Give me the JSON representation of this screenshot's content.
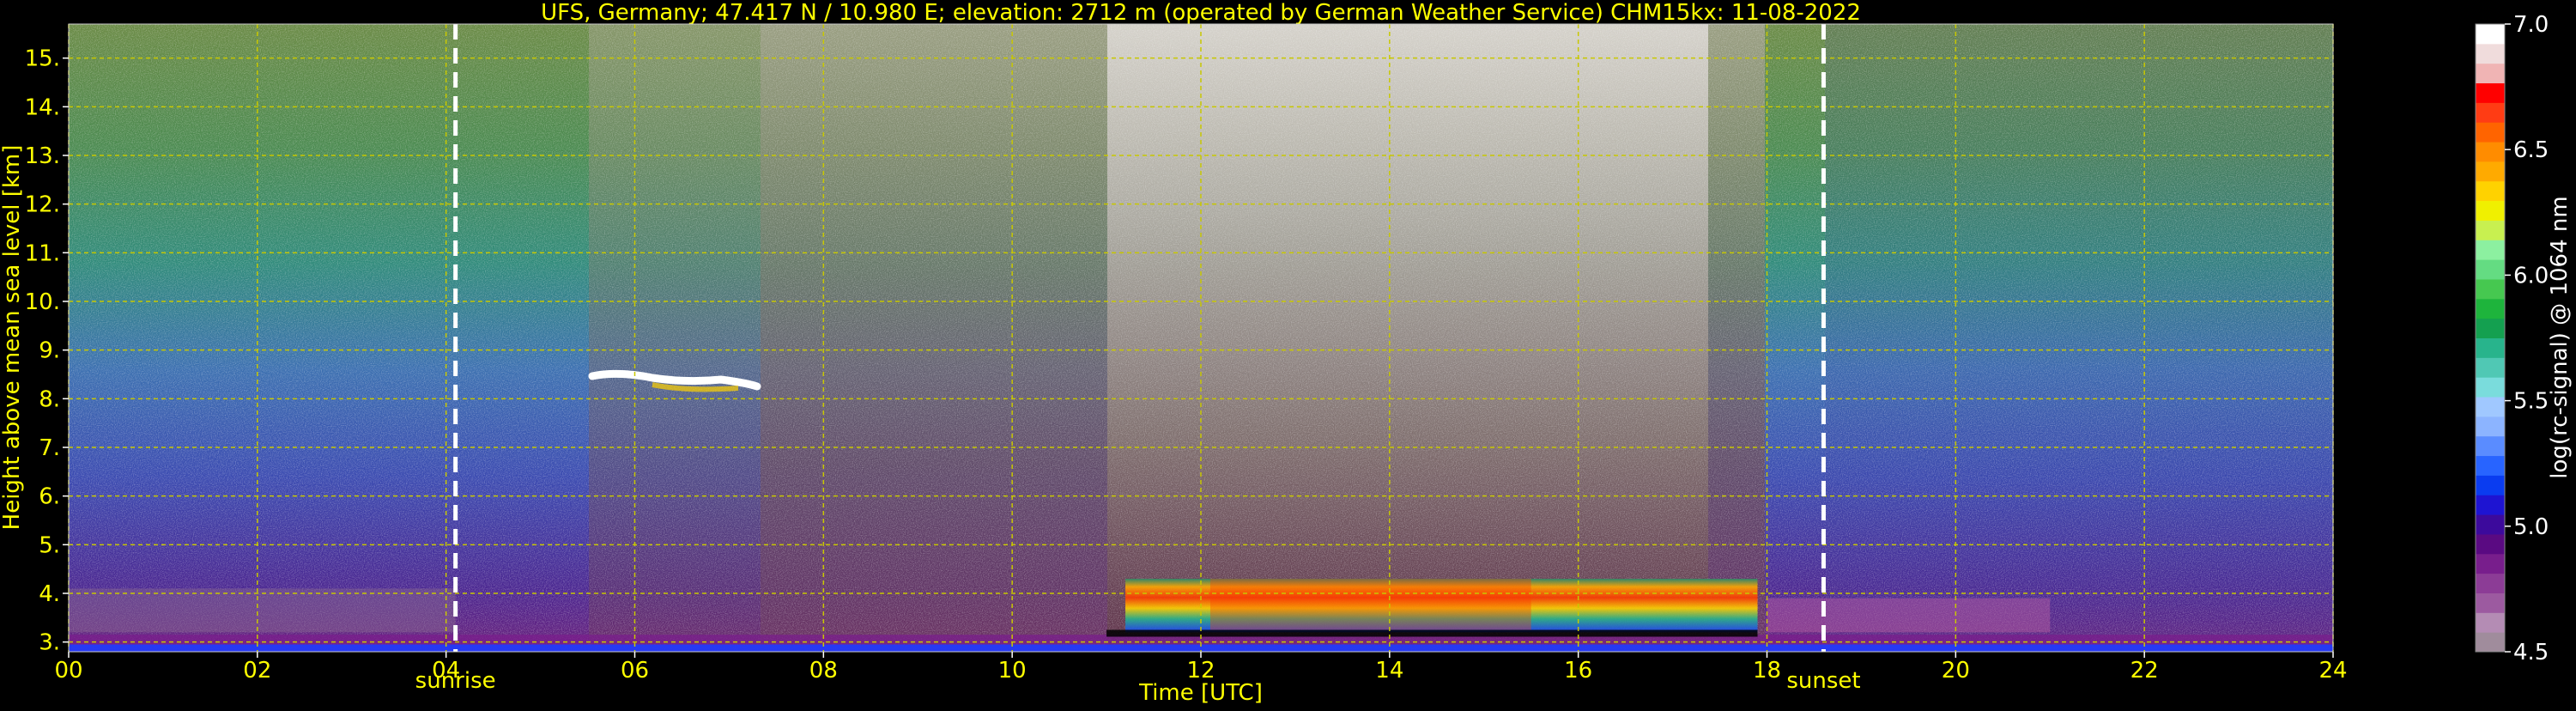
{
  "title": "UFS, Germany; 47.417 N / 10.980 E; elevation: 2712 m  (operated by German Weather Service)    CHM15kx: 11-08-2022",
  "colors": {
    "text_yellow": "#ffff00",
    "grid_yellow": "#c8c800",
    "background": "#000000",
    "colorbar_text": "#ffffff"
  },
  "chart_data": {
    "type": "heatmap",
    "title": "UFS, Germany; 47.417 N / 10.980 E; elevation: 2712 m  (operated by German Weather Service)    CHM15kx: 11-08-2022",
    "xlabel": "Time [UTC]",
    "ylabel": "Height above mean sea level [km]",
    "xlim": [
      0,
      24
    ],
    "ylim": [
      2.8,
      15.7
    ],
    "x_ticks": [
      0,
      2,
      4,
      6,
      8,
      10,
      12,
      14,
      16,
      18,
      20,
      22,
      24
    ],
    "x_tick_labels": [
      "00",
      "02",
      "04",
      "06",
      "08",
      "10",
      "12",
      "14",
      "16",
      "18",
      "20",
      "22",
      "24"
    ],
    "y_ticks": [
      3,
      4,
      5,
      6,
      7,
      8,
      9,
      10,
      11,
      12,
      13,
      14,
      15
    ],
    "y_tick_labels": [
      "3.",
      "4.",
      "5.",
      "6.",
      "7.",
      "8.",
      "9.",
      "10.",
      "11.",
      "12.",
      "13.",
      "14.",
      "15."
    ],
    "grid": true,
    "markers": [
      {
        "label": "sunrise",
        "time": 4.1
      },
      {
        "label": "sunset",
        "time": 18.6
      }
    ],
    "colorbar": {
      "label": "log(rc-signal) @ 1064 nm",
      "range": [
        4.5,
        7.0
      ],
      "tick_labels": [
        "4.5",
        "5.0",
        "5.5",
        "6.0",
        "6.5",
        "7.0"
      ],
      "tick_values": [
        4.5,
        5.0,
        5.5,
        6.0,
        6.5,
        7.0
      ],
      "colors": [
        "#a08c9c",
        "#b48cb4",
        "#9c5aa0",
        "#8c3c96",
        "#781e8c",
        "#5a0a82",
        "#3c0a9c",
        "#1e14d2",
        "#0a3cf0",
        "#2864ff",
        "#5a8cff",
        "#8cb4ff",
        "#a0c8ff",
        "#7adcdc",
        "#50c8b4",
        "#28b48c",
        "#14a050",
        "#1eb43c",
        "#46c850",
        "#64dc82",
        "#8cf0a0",
        "#c8f050",
        "#f0f000",
        "#ffd200",
        "#ffaa00",
        "#ff8c00",
        "#ff6400",
        "#ff3c14",
        "#ff0000",
        "#f0b4b4",
        "#f0dcdc",
        "#ffffff"
      ]
    }
  }
}
